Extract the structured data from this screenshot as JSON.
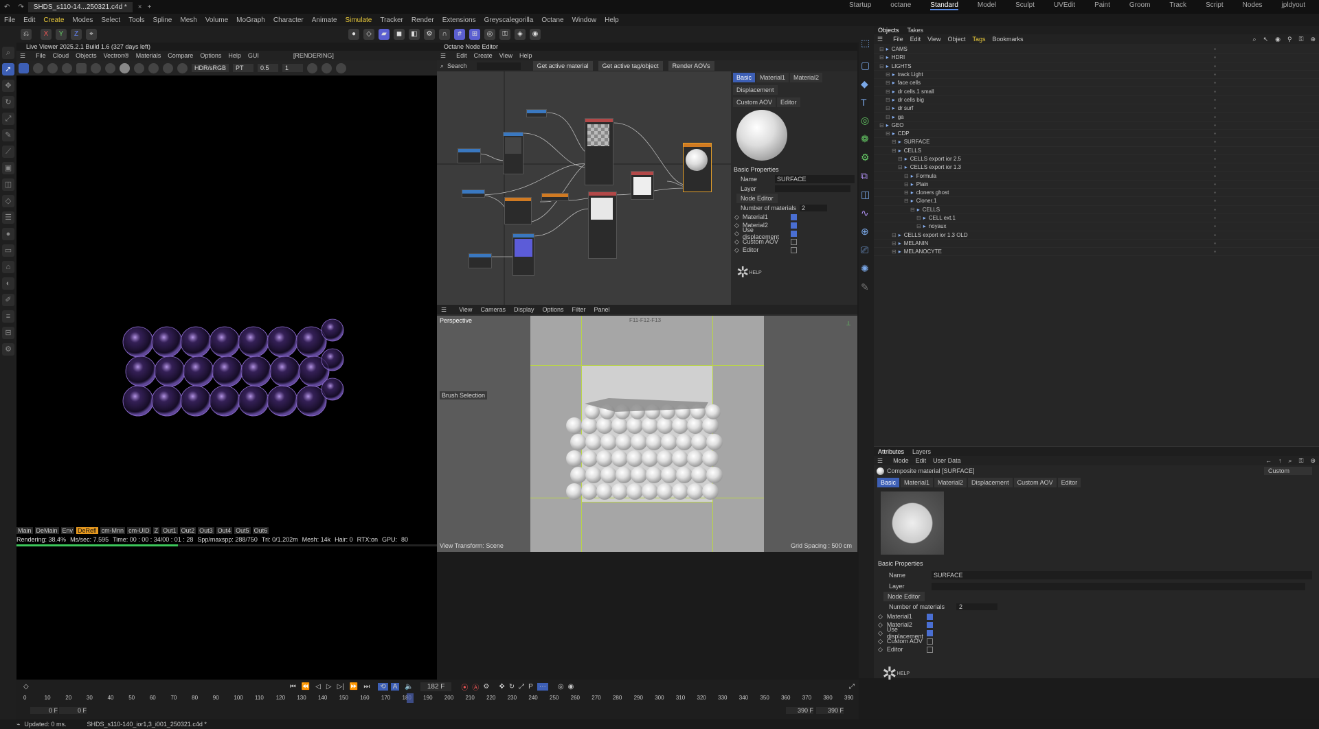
{
  "title_tab": "SHDS_s110-14...250321.c4d *",
  "menus": [
    "File",
    "Edit",
    "Create",
    "Modes",
    "Select",
    "Tools",
    "Spline",
    "Mesh",
    "Volume",
    "MoGraph",
    "Character",
    "Animate",
    "Simulate",
    "Tracker",
    "Render",
    "Extensions",
    "Greyscalegorilla",
    "Octane",
    "Window",
    "Help"
  ],
  "layouts": [
    "Startup",
    "octane",
    "Standard",
    "Model",
    "Sculpt",
    "UVEdit",
    "Paint",
    "Groom",
    "Track",
    "Script",
    "Nodes",
    "jpldyout"
  ],
  "live_viewer": {
    "title": "Live Viewer 2025.2.1 Build 1.6 (327 days left)",
    "menu": [
      "File",
      "Cloud",
      "Objects",
      "Vectron®",
      "Materials",
      "Compare",
      "Options",
      "Help",
      "GUI"
    ],
    "state": "[RENDERING]",
    "colorspace": "HDR/sRGB",
    "kernel": "PT",
    "value1": "0.5",
    "value2": "1",
    "tabs": [
      "Main",
      "DeMain",
      "Env",
      "DeRefl",
      "cm-Mnn",
      "cm-UID",
      "Z",
      "Out1",
      "Out2",
      "Out3",
      "Out4",
      "Out5",
      "Out6"
    ],
    "active_tab": "DeRefl",
    "status": [
      "Rendering: 38.4%",
      "Ms/sec: 7.595",
      "Time: 00 : 00 : 34/00 : 01 : 28",
      "Spp/maxspp: 288/750",
      "Tri: 0/1.202m",
      "Mesh: 14k",
      "Hair: 0",
      "RTX:on",
      "GPU:",
      "80"
    ],
    "progress": 38.4
  },
  "node_editor": {
    "title": "Octane Node Editor",
    "menu": [
      "Edit",
      "Create",
      "View",
      "Help"
    ],
    "search": "Search",
    "buttons": [
      "Get active material",
      "Get active tag/object",
      "Render AOVs"
    ],
    "tabs": [
      "Basic",
      "Material1",
      "Material2",
      "Displacement"
    ],
    "tabs2": [
      "Custom AOV",
      "Editor"
    ],
    "section": "Basic Properties",
    "name_label": "Name",
    "name_value": "SURFACE",
    "layer_label": "Layer",
    "node_editor_btn": "Node Editor",
    "num_label": "Number of materials",
    "num_value": "2",
    "checks": [
      {
        "label": "Material1",
        "on": true
      },
      {
        "label": "Material2",
        "on": true
      },
      {
        "label": "Use displacement",
        "on": true
      },
      {
        "label": "Custom AOV",
        "on": false
      },
      {
        "label": "Editor",
        "on": false
      }
    ],
    "help": "HELP"
  },
  "viewport": {
    "menu": [
      "View",
      "Cameras",
      "Display",
      "Options",
      "Filter",
      "Panel"
    ],
    "camera": "Perspective",
    "frame_label": "F11-F12-F13",
    "brush": "Brush Selection",
    "view_transform": "View Transform: Scene",
    "grid": "Grid Spacing : 500 cm"
  },
  "objects": {
    "tabs": [
      "Objects",
      "Takes"
    ],
    "menu": [
      "File",
      "Edit",
      "View",
      "Object",
      "Tags",
      "Bookmarks"
    ],
    "rows": [
      {
        "n": "CAMS",
        "d": 0
      },
      {
        "n": "HDRI",
        "d": 0
      },
      {
        "n": "LIGHTS",
        "d": 0
      },
      {
        "n": "track Light",
        "d": 1
      },
      {
        "n": "face cells",
        "d": 1
      },
      {
        "n": "dr cells.1 small",
        "d": 1
      },
      {
        "n": "dr cells big",
        "d": 1
      },
      {
        "n": "dr surf",
        "d": 1
      },
      {
        "n": "ga",
        "d": 1
      },
      {
        "n": "GEO",
        "d": 0
      },
      {
        "n": "CDP",
        "d": 1
      },
      {
        "n": "SURFACE",
        "d": 2
      },
      {
        "n": "CELLS",
        "d": 2
      },
      {
        "n": "CELLS export ior 2.5",
        "d": 3
      },
      {
        "n": "CELLS export ior 1.3",
        "d": 3
      },
      {
        "n": "Formula",
        "d": 4
      },
      {
        "n": "Plain",
        "d": 4
      },
      {
        "n": "cloners ghost",
        "d": 4
      },
      {
        "n": "Cloner.1",
        "d": 4
      },
      {
        "n": "CELLS",
        "d": 5
      },
      {
        "n": "CELL ext.1",
        "d": 6
      },
      {
        "n": "noyaux",
        "d": 6
      },
      {
        "n": "CELLS export ior 1.3 OLD",
        "d": 2
      },
      {
        "n": "MELANIN",
        "d": 2
      },
      {
        "n": "MELANOCYTE",
        "d": 2
      }
    ]
  },
  "attributes": {
    "tabs": [
      "Attributes",
      "Layers"
    ],
    "menu": [
      "Mode",
      "Edit",
      "User Data"
    ],
    "header": "Composite material [SURFACE]",
    "dropdown": "Custom",
    "tabs2": [
      "Basic",
      "Material1",
      "Material2",
      "Displacement",
      "Custom AOV",
      "Editor"
    ],
    "section": "Basic Properties",
    "name_label": "Name",
    "name_value": "SURFACE",
    "layer_label": "Layer",
    "node_editor_btn": "Node Editor",
    "num_label": "Number of materials",
    "num_value": "2",
    "checks": [
      {
        "label": "Material1",
        "on": true
      },
      {
        "label": "Material2",
        "on": true
      },
      {
        "label": "Use displacement",
        "on": true
      },
      {
        "label": "Custom AOV",
        "on": false
      },
      {
        "label": "Editor",
        "on": false
      }
    ],
    "help": "HELP"
  },
  "timeline": {
    "frame": "182 F",
    "start": "0 F",
    "start2": "0 F",
    "end": "390 F",
    "end2": "390 F",
    "current": 182,
    "ticks": [
      0,
      10,
      20,
      30,
      40,
      50,
      60,
      70,
      80,
      90,
      100,
      110,
      120,
      130,
      140,
      150,
      160,
      170,
      180,
      190,
      200,
      210,
      220,
      230,
      240,
      250,
      260,
      270,
      280,
      290,
      300,
      310,
      320,
      330,
      340,
      350,
      360,
      370,
      380,
      390
    ]
  },
  "status": {
    "left": "Updated: 0 ms.",
    "file": "SHDS_s110-140_ior1,3_i001_250321.c4d *"
  }
}
